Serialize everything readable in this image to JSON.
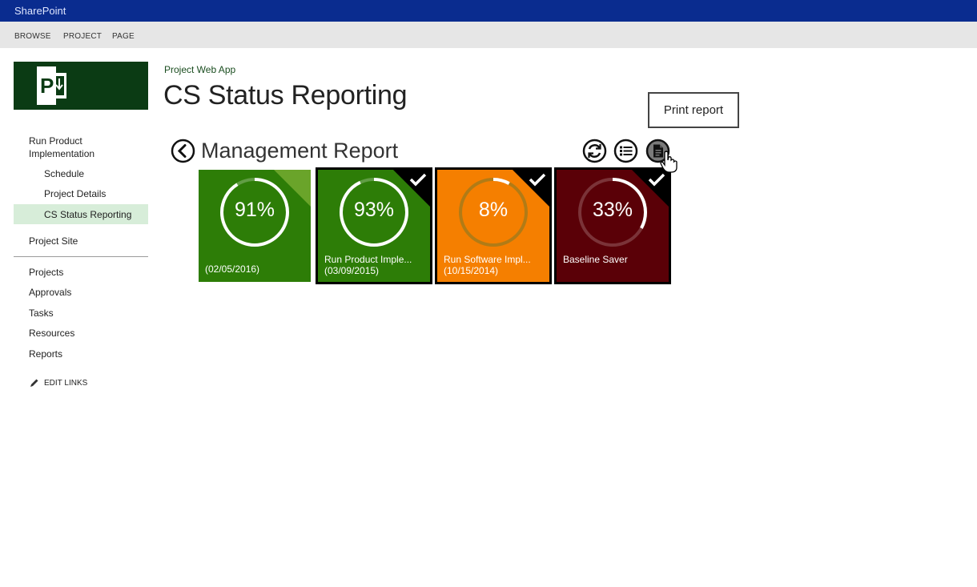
{
  "topbar": {
    "brand": "SharePoint"
  },
  "ribbon": {
    "tabs": [
      "BROWSE",
      "PROJECT",
      "PAGE"
    ]
  },
  "header": {
    "breadcrumb": "Project Web App",
    "title": "CS Status Reporting"
  },
  "nav": {
    "items": [
      {
        "label": "Run Product Implementation"
      },
      {
        "label": "Schedule"
      },
      {
        "label": "Project Details"
      },
      {
        "label": "CS Status Reporting",
        "selected": true
      },
      {
        "label": "Project Site"
      },
      {
        "label": "Projects"
      },
      {
        "label": "Approvals"
      },
      {
        "label": "Tasks"
      },
      {
        "label": "Resources"
      },
      {
        "label": "Reports"
      }
    ],
    "edit_links": "EDIT LINKS"
  },
  "tooltip": {
    "text": "Print report"
  },
  "report": {
    "title": "Management Report",
    "tools": [
      "refresh-icon",
      "list-icon",
      "print-report-icon"
    ]
  },
  "tiles": [
    {
      "percent": "91%",
      "value": 0.91,
      "name": "",
      "date": "(02/05/2016)",
      "color": "#2d7d07",
      "selected": false,
      "corner": "#6aa42a"
    },
    {
      "percent": "93%",
      "value": 0.93,
      "name": "Run Product Imple...",
      "date": "(03/09/2015)",
      "color": "#2d7d07",
      "selected": true,
      "corner": "#000000"
    },
    {
      "percent": "8%",
      "value": 0.08,
      "name": "Run Software Impl...",
      "date": "(10/15/2014)",
      "color": "#f57f00",
      "selected": true,
      "corner": "#000000"
    },
    {
      "percent": "33%",
      "value": 0.33,
      "name": "Baseline Saver",
      "date": "",
      "color": "#5a0007",
      "selected": true,
      "corner": "#000000"
    }
  ],
  "colors": {
    "topbar": "#0a2c8f",
    "ribbon": "#e6e6e6",
    "logo": "#0b3b14",
    "nav_selected": "#d7edd9"
  }
}
